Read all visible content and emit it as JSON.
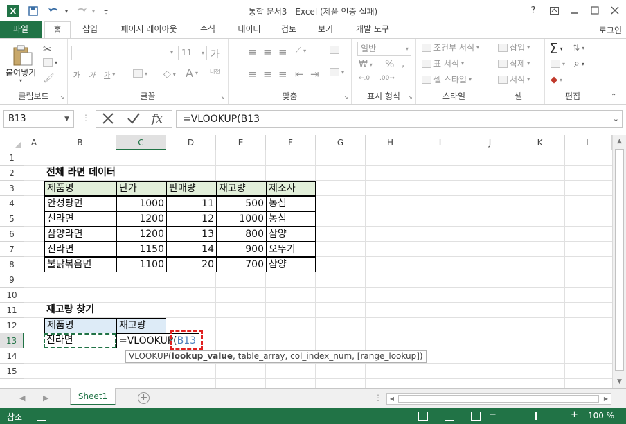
{
  "window": {
    "title": "통합 문서3 - Excel (제품 인증 실패)",
    "logo": "X"
  },
  "qat_icons": [
    "save-icon",
    "undo-icon",
    "redo-icon",
    "customize-qat-icon"
  ],
  "ribbon_tabs": {
    "file": "파일",
    "tabs": [
      "홈",
      "삽입",
      "페이지 레이아웃",
      "수식",
      "데이터",
      "검토",
      "보기",
      "개발 도구"
    ],
    "active": "홈",
    "login": "로그인"
  },
  "ribbon": {
    "clipboard": {
      "paste": "붙여넣기",
      "label": "클립보드"
    },
    "font": {
      "name": "",
      "size": "11",
      "grow": "가",
      "shrink": "가",
      "bold": "가",
      "italic": "가",
      "underline": "가",
      "phonetic": "내천",
      "label": "글꼴"
    },
    "alignment": {
      "label": "맞춤"
    },
    "number": {
      "format": "일반",
      "percent": "%",
      "label": "표시 형식"
    },
    "styles": {
      "conditional": "조건부 서식",
      "table": "표 서식",
      "cell": "셀 스타일",
      "label": "스타일"
    },
    "cells": {
      "insert": "삽입",
      "delete": "삭제",
      "format": "서식",
      "label": "셀"
    },
    "editing": {
      "label": "편집"
    }
  },
  "formula_bar": {
    "name_box": "B13",
    "fx": "fx",
    "formula": "=VLOOKUP(B13"
  },
  "columns": [
    "A",
    "B",
    "C",
    "D",
    "E",
    "F",
    "G",
    "H",
    "I",
    "J",
    "K",
    "L"
  ],
  "selected_column": "C",
  "rows": [
    "1",
    "2",
    "3",
    "4",
    "5",
    "6",
    "7",
    "8",
    "9",
    "10",
    "11",
    "12",
    "13",
    "14",
    "15"
  ],
  "selected_row": "13",
  "table1": {
    "title": "전체 라면 데이터",
    "headers": [
      "제품명",
      "단가",
      "판매량",
      "재고량",
      "제조사"
    ],
    "rows": [
      [
        "안성탕면",
        "1000",
        "11",
        "500",
        "농심"
      ],
      [
        "신라면",
        "1200",
        "12",
        "1000",
        "농심"
      ],
      [
        "삼양라면",
        "1200",
        "13",
        "800",
        "삼양"
      ],
      [
        "진라면",
        "1150",
        "14",
        "900",
        "오뚜기"
      ],
      [
        "불닭볶음면",
        "1100",
        "20",
        "700",
        "삼양"
      ]
    ]
  },
  "lookup": {
    "title": "재고량 찾기",
    "headers": [
      "제품명",
      "재고량"
    ],
    "product": "진라면",
    "formula_prefix": "=VLOOKUP(",
    "formula_ref": "B13"
  },
  "tooltip": {
    "fn": "VLOOKUP(",
    "arg1": "lookup_value",
    "rest": ", table_array, col_index_num, [range_lookup])"
  },
  "sheet_tabs": [
    "Sheet1"
  ],
  "status": {
    "mode": "참조",
    "zoom": "100 %"
  },
  "colors": {
    "excel_green": "#217346",
    "header_green_fill": "#e2efda",
    "header_blue_fill": "#ddebf7",
    "ref_highlight": "#e02020"
  }
}
